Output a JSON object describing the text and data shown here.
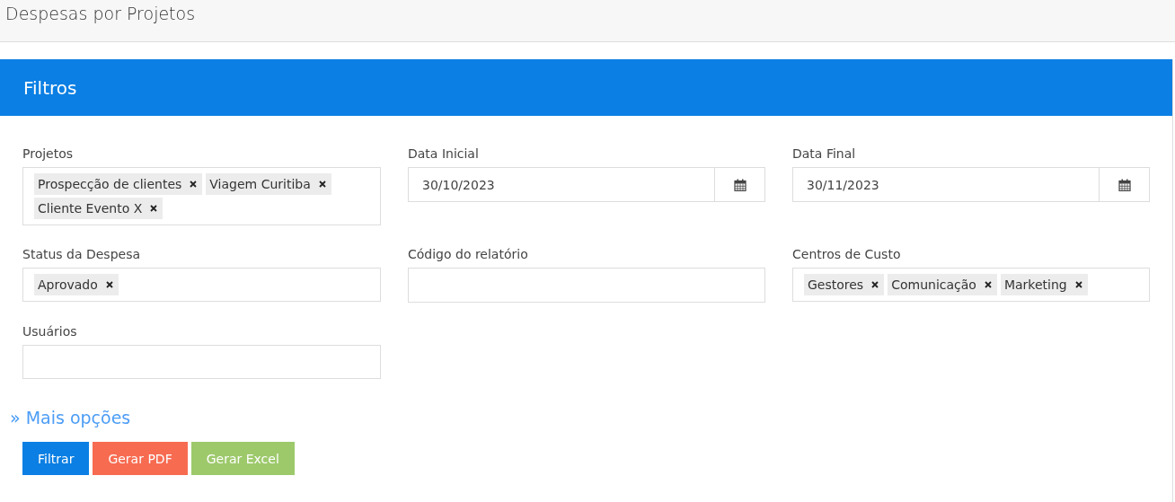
{
  "page_title": "Despesas por Projetos",
  "panel": {
    "title": "Filtros",
    "fields": [
      {
        "label": "Projetos",
        "kind": "tags",
        "tags": [
          "Prospecção de clientes",
          "Viagem Curitiba",
          "Cliente Evento X"
        ]
      },
      {
        "label": "Data Inicial",
        "kind": "date",
        "value": "30/10/2023"
      },
      {
        "label": "Data Final",
        "kind": "date",
        "value": "30/11/2023"
      },
      {
        "label": "Status da Despesa",
        "kind": "tags",
        "tags": [
          "Aprovado"
        ]
      },
      {
        "label": "Código do relatório",
        "kind": "text"
      },
      {
        "label": "Centros de Custo",
        "kind": "tags",
        "tags": [
          "Gestores",
          "Comunicação",
          "Marketing"
        ]
      },
      {
        "label": "Usuários",
        "kind": "tags"
      }
    ],
    "more_link": "» Mais opções",
    "buttons": [
      {
        "label": "Filtrar",
        "kind": "primary"
      },
      {
        "label": "Gerar PDF",
        "kind": "danger"
      },
      {
        "label": "Gerar Excel",
        "kind": "success"
      }
    ]
  }
}
